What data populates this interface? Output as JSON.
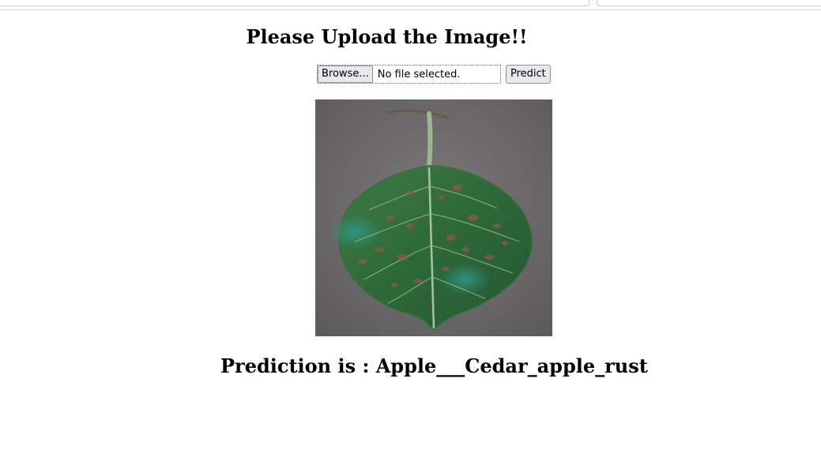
{
  "page": {
    "title": "Please Upload the Image!!",
    "browse_label": "Browse...",
    "file_status": "No file selected.",
    "predict_label": "Predict",
    "prediction_prefix": "Prediction is : ",
    "prediction_value": "Apple___Cedar_apple_rust"
  },
  "colors": {
    "background": "#ffffff",
    "text": "#000000",
    "button_bg": "#e9e9ed",
    "leaf_green": "#2e6b3c",
    "backdrop_gray": "#6f6c6e"
  }
}
